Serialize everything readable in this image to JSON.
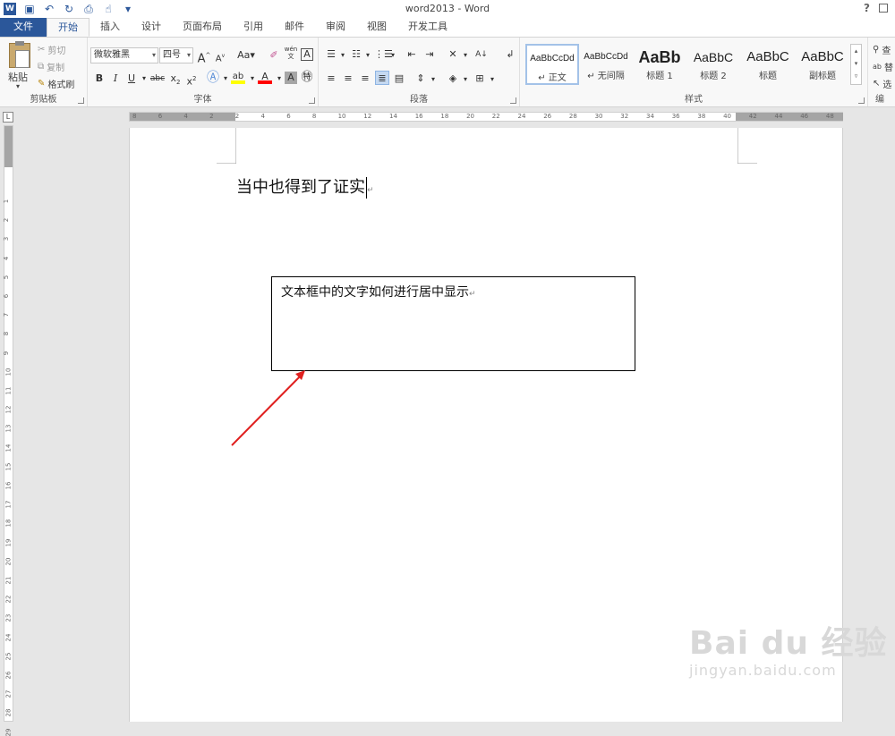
{
  "window": {
    "title": "word2013 - Word",
    "help": "?"
  },
  "tabs": [
    "文件",
    "开始",
    "插入",
    "设计",
    "页面布局",
    "引用",
    "邮件",
    "审阅",
    "视图",
    "开发工具"
  ],
  "clipboard": {
    "paste": "粘贴",
    "cut": "剪切",
    "copy": "复制",
    "format_painter": "格式刷",
    "label": "剪贴板"
  },
  "font": {
    "name": "微软雅黑",
    "size": "四号",
    "label": "字体",
    "pinyin": "wén"
  },
  "paragraph": {
    "label": "段落"
  },
  "styles": {
    "label": "样式",
    "items": [
      {
        "sample": "AaBbCcDd",
        "name": "↵ 正文"
      },
      {
        "sample": "AaBbCcDd",
        "name": "↵ 无间隔"
      },
      {
        "sample": "AaBb",
        "name": "标题 1"
      },
      {
        "sample": "AaBbC",
        "name": "标题 2"
      },
      {
        "sample": "AaBbC",
        "name": "标题"
      },
      {
        "sample": "AaBbC",
        "name": "副标题"
      }
    ]
  },
  "editing": {
    "find": "查",
    "replace": "替",
    "select": "选",
    "label": "编"
  },
  "ruler": {
    "h_ticks": [
      "8",
      "6",
      "4",
      "2",
      "2",
      "4",
      "6",
      "8",
      "10",
      "12",
      "14",
      "16",
      "18",
      "20",
      "22",
      "24",
      "26",
      "28",
      "30",
      "32",
      "34",
      "36",
      "38",
      "40",
      "42",
      "44",
      "46",
      "48"
    ],
    "v_ticks": [
      "1",
      "2",
      "3",
      "4",
      "5",
      "6",
      "7",
      "8",
      "9",
      "10",
      "11",
      "12",
      "13",
      "14",
      "15",
      "16",
      "17",
      "18",
      "19",
      "20",
      "21",
      "22",
      "23",
      "24",
      "25",
      "26",
      "27",
      "28",
      "29"
    ]
  },
  "document": {
    "heading": "当中也得到了证实",
    "textbox_text": "文本框中的文字如何进行居中显示",
    "para_mark": "↵"
  },
  "watermark": {
    "main": "Bai du 经验",
    "url": "jingyan.baidu.com"
  },
  "colors": {
    "accent": "#2b579a",
    "arrow": "#e0201f",
    "highlight": "#ffff00",
    "font_color": "#ff0000"
  }
}
